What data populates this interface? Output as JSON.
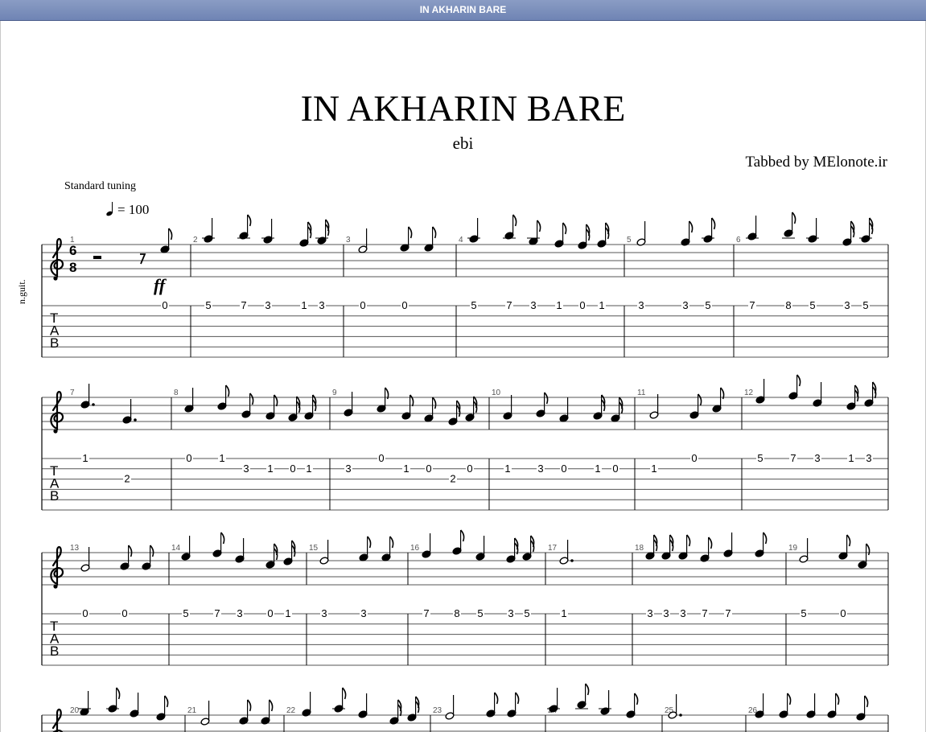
{
  "window": {
    "title": "IN AKHARIN BARE"
  },
  "header": {
    "title": "IN AKHARIN BARE",
    "artist": "ebi",
    "credit": "Tabbed by MElonote.ir",
    "tuning": "Standard tuning",
    "tempo_text": "= 100",
    "instrument": "n.guit."
  },
  "time_signature": {
    "top": "6",
    "bottom": "8"
  },
  "dynamic": "ff",
  "systems": [
    {
      "measures": [
        {
          "number": "1",
          "tab": [
            {
              "s": 1,
              "f": "0"
            }
          ]
        },
        {
          "number": "2",
          "tab": [
            {
              "s": 1,
              "f": "5"
            },
            {
              "s": 1,
              "f": "7"
            },
            {
              "s": 1,
              "f": "3"
            },
            {
              "s": 1,
              "f": "1"
            },
            {
              "s": 1,
              "f": "3"
            }
          ]
        },
        {
          "number": "3",
          "tab": [
            {
              "s": 1,
              "f": "0"
            },
            {
              "s": 1,
              "f": "0"
            }
          ]
        },
        {
          "number": "4",
          "tab": [
            {
              "s": 1,
              "f": "5"
            },
            {
              "s": 1,
              "f": "7"
            },
            {
              "s": 1,
              "f": "3"
            },
            {
              "s": 1,
              "f": "1"
            },
            {
              "s": 1,
              "f": "0"
            },
            {
              "s": 1,
              "f": "1"
            }
          ]
        },
        {
          "number": "5",
          "tab": [
            {
              "s": 1,
              "f": "3"
            },
            {
              "s": 1,
              "f": "3"
            },
            {
              "s": 1,
              "f": "5"
            }
          ]
        },
        {
          "number": "6",
          "tab": [
            {
              "s": 1,
              "f": "7"
            },
            {
              "s": 1,
              "f": "8"
            },
            {
              "s": 1,
              "f": "5"
            },
            {
              "s": 1,
              "f": "3"
            },
            {
              "s": 1,
              "f": "5"
            }
          ]
        }
      ]
    },
    {
      "measures": [
        {
          "number": "7",
          "tab": [
            {
              "s": 1,
              "f": "1"
            },
            {
              "s": 3,
              "f": "2"
            }
          ]
        },
        {
          "number": "8",
          "tab": [
            {
              "s": 1,
              "f": "0"
            },
            {
              "s": 1,
              "f": "1"
            },
            {
              "s": 2,
              "f": "3"
            },
            {
              "s": 2,
              "f": "1"
            },
            {
              "s": 2,
              "f": "0"
            },
            {
              "s": 2,
              "f": "1"
            }
          ]
        },
        {
          "number": "9",
          "tab": [
            {
              "s": 2,
              "f": "3"
            },
            {
              "s": 1,
              "f": "0"
            },
            {
              "s": 2,
              "f": "1"
            },
            {
              "s": 2,
              "f": "0"
            },
            {
              "s": 3,
              "f": "2"
            },
            {
              "s": 2,
              "f": "0"
            }
          ]
        },
        {
          "number": "10",
          "tab": [
            {
              "s": 2,
              "f": "1"
            },
            {
              "s": 2,
              "f": "3"
            },
            {
              "s": 2,
              "f": "0"
            },
            {
              "s": 2,
              "f": "1"
            },
            {
              "s": 2,
              "f": "0"
            }
          ]
        },
        {
          "number": "11",
          "tab": [
            {
              "s": 2,
              "f": "1"
            },
            {
              "s": 1,
              "f": "0"
            }
          ]
        },
        {
          "number": "12",
          "tab": [
            {
              "s": 1,
              "f": "5"
            },
            {
              "s": 1,
              "f": "7"
            },
            {
              "s": 1,
              "f": "3"
            },
            {
              "s": 1,
              "f": "1"
            },
            {
              "s": 1,
              "f": "3"
            }
          ]
        }
      ]
    },
    {
      "measures": [
        {
          "number": "13",
          "tab": [
            {
              "s": 1,
              "f": "0"
            },
            {
              "s": 1,
              "f": "0"
            }
          ]
        },
        {
          "number": "14",
          "tab": [
            {
              "s": 1,
              "f": "5"
            },
            {
              "s": 1,
              "f": "7"
            },
            {
              "s": 1,
              "f": "3"
            },
            {
              "s": 1,
              "f": "0"
            },
            {
              "s": 1,
              "f": "1"
            }
          ]
        },
        {
          "number": "15",
          "tab": [
            {
              "s": 1,
              "f": "3"
            },
            {
              "s": 1,
              "f": "3"
            }
          ]
        },
        {
          "number": "16",
          "tab": [
            {
              "s": 1,
              "f": "7"
            },
            {
              "s": 1,
              "f": "8"
            },
            {
              "s": 1,
              "f": "5"
            },
            {
              "s": 1,
              "f": "3"
            },
            {
              "s": 1,
              "f": "5"
            }
          ]
        },
        {
          "number": "17",
          "tab": [
            {
              "s": 1,
              "f": "1"
            }
          ]
        },
        {
          "number": "18",
          "tab": [
            {
              "s": 1,
              "f": "3"
            },
            {
              "s": 1,
              "f": "3"
            },
            {
              "s": 1,
              "f": "3"
            },
            {
              "s": 1,
              "f": "7"
            },
            {
              "s": 1,
              "f": "7"
            }
          ]
        },
        {
          "number": "19",
          "tab": [
            {
              "s": 1,
              "f": "5"
            },
            {
              "s": 1,
              "f": "0"
            }
          ]
        }
      ]
    },
    {
      "measures": [
        {
          "number": "20"
        },
        {
          "number": "21"
        },
        {
          "number": "22"
        },
        {
          "number": "23"
        },
        {
          "number": "24"
        },
        {
          "number": "25"
        },
        {
          "number": "26"
        }
      ]
    }
  ]
}
